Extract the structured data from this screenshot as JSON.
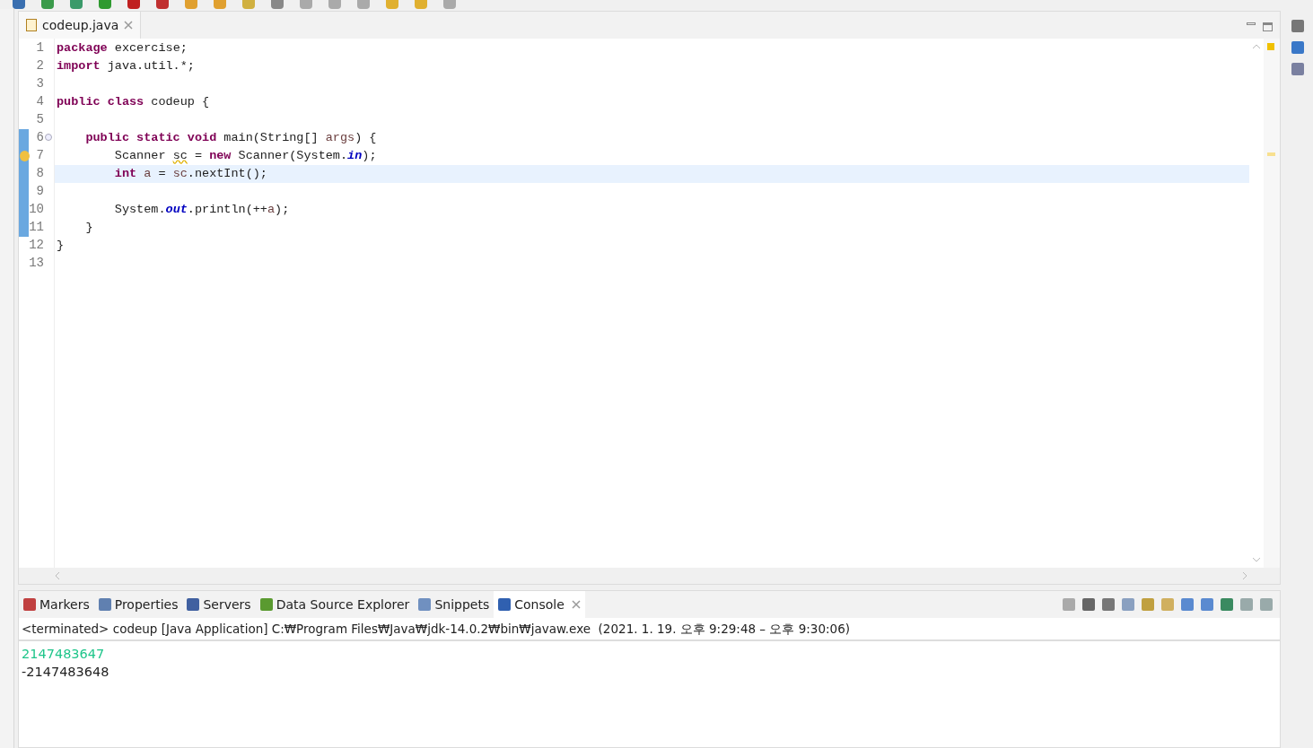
{
  "editor": {
    "tabs": [
      {
        "label": "codeup.java",
        "selected": true,
        "closable": true
      }
    ],
    "lines": [
      {
        "number": "1",
        "highlighted": false,
        "changed": false,
        "fold": false,
        "warning": false,
        "tokens": [
          {
            "text": "package",
            "kind": "keyword"
          },
          {
            "text": " excercise;",
            "kind": "plain"
          }
        ]
      },
      {
        "number": "2",
        "highlighted": false,
        "changed": false,
        "fold": false,
        "warning": false,
        "tokens": [
          {
            "text": "import",
            "kind": "keyword"
          },
          {
            "text": " java.util.*;",
            "kind": "plain"
          }
        ]
      },
      {
        "number": "3",
        "highlighted": false,
        "changed": false,
        "fold": false,
        "warning": false
      },
      {
        "number": "4",
        "highlighted": false,
        "changed": false,
        "fold": false,
        "warning": false,
        "tokens": [
          {
            "text": "public class",
            "kind": "keyword"
          },
          {
            "text": " codeup {",
            "kind": "plain"
          }
        ]
      },
      {
        "number": "5",
        "highlighted": false,
        "changed": false,
        "fold": false,
        "warning": false
      },
      {
        "number": "6",
        "highlighted": false,
        "changed": true,
        "fold": true,
        "warning": false,
        "tokens": [
          {
            "text": "    public static void",
            "kind": "keyword"
          },
          {
            "text": " main(String[] ",
            "kind": "plain"
          },
          {
            "text": "args",
            "kind": "local"
          },
          {
            "text": ") {",
            "kind": "plain"
          }
        ]
      },
      {
        "number": "7",
        "highlighted": false,
        "changed": true,
        "fold": false,
        "warning": true,
        "tokens": [
          {
            "text": "        Scanner ",
            "kind": "plain"
          },
          {
            "text": "sc",
            "kind": "warned"
          },
          {
            "text": " = ",
            "kind": "plain"
          },
          {
            "text": "new",
            "kind": "keyword"
          },
          {
            "text": " Scanner(System.",
            "kind": "plain"
          },
          {
            "text": "in",
            "kind": "static"
          },
          {
            "text": ");",
            "kind": "plain"
          }
        ]
      },
      {
        "number": "8",
        "highlighted": true,
        "changed": true,
        "fold": false,
        "warning": false,
        "tokens": [
          {
            "text": "        int",
            "kind": "keyword"
          },
          {
            "text": " a",
            "kind": "local"
          },
          {
            "text": " = ",
            "kind": "plain"
          },
          {
            "text": "sc",
            "kind": "local"
          },
          {
            "text": ".nextInt();",
            "kind": "plain"
          }
        ]
      },
      {
        "number": "9",
        "highlighted": false,
        "changed": true,
        "fold": false,
        "warning": false
      },
      {
        "number": "10",
        "highlighted": false,
        "changed": true,
        "fold": false,
        "warning": false,
        "tokens": [
          {
            "text": "        System.",
            "kind": "plain"
          },
          {
            "text": "out",
            "kind": "static"
          },
          {
            "text": ".println(++",
            "kind": "plain"
          },
          {
            "text": "a",
            "kind": "local"
          },
          {
            "text": ");",
            "kind": "plain"
          }
        ]
      },
      {
        "number": "11",
        "highlighted": false,
        "changed": true,
        "fold": false,
        "warning": false,
        "tokens": [
          {
            "text": "    }",
            "kind": "plain"
          }
        ]
      },
      {
        "number": "12",
        "highlighted": false,
        "changed": false,
        "fold": false,
        "warning": false,
        "tokens": [
          {
            "text": "}",
            "kind": "plain"
          }
        ]
      },
      {
        "number": "13",
        "highlighted": false,
        "changed": false,
        "fold": false,
        "warning": false
      }
    ]
  },
  "panel": {
    "tabs": [
      {
        "label": "Markers",
        "selected": false,
        "closable": false
      },
      {
        "label": "Properties",
        "selected": false,
        "closable": false
      },
      {
        "label": "Servers",
        "selected": false,
        "closable": false
      },
      {
        "label": "Data Source Explorer",
        "selected": false,
        "closable": false
      },
      {
        "label": "Snippets",
        "selected": false,
        "closable": false
      },
      {
        "label": "Console",
        "selected": true,
        "closable": true
      }
    ],
    "console": {
      "header": "<terminated> codeup [Java Application] C:₩Program Files₩Java₩jdk-14.0.2₩bin₩javaw.exe  (2021. 1. 19. 오후 9:29:48 – 오후 9:30:06)",
      "lines": [
        {
          "text": "2147483647",
          "kind": "input"
        },
        {
          "text": "-2147483648",
          "kind": "output"
        }
      ]
    }
  }
}
